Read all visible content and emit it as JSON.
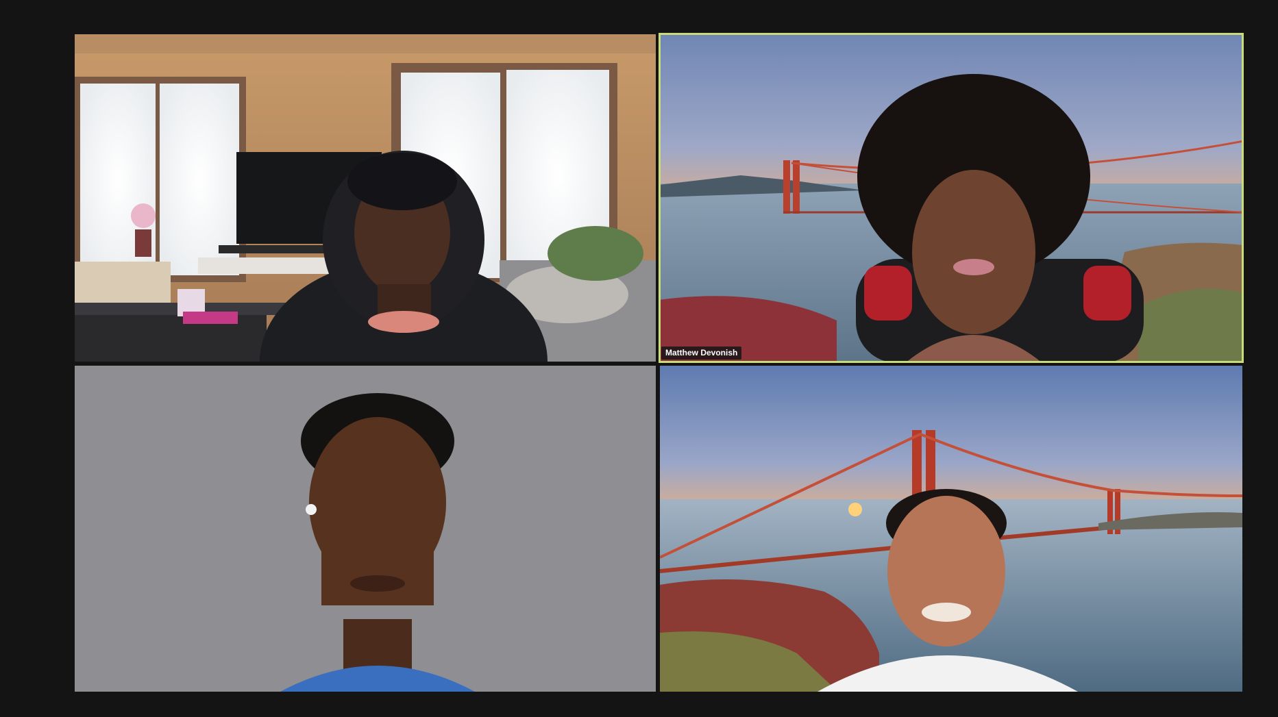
{
  "meeting": {
    "view": "gallery",
    "participants": [
      {
        "name": "",
        "active_speaker": false
      },
      {
        "name": "Matthew Devonish",
        "active_speaker": true
      },
      {
        "name": "",
        "active_speaker": false
      },
      {
        "name": "",
        "active_speaker": false
      }
    ]
  },
  "colors": {
    "background": "#141414",
    "active_speaker_border": "#c9dc7a",
    "virtual_bg_gray": "#8f8e93"
  }
}
